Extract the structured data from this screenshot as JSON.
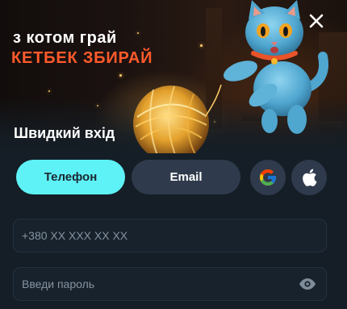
{
  "banner": {
    "headline_line1": "з котом грай",
    "headline_line2": "КЕТБЕК ЗБИРАЙ",
    "headline_line2_color": "#ff5a2b"
  },
  "modal": {
    "title": "Швидкий вхід",
    "close_icon": "close-icon"
  },
  "login_tabs": [
    {
      "label": "Телефон",
      "active": true
    },
    {
      "label": "Email",
      "active": false
    }
  ],
  "social_logins": [
    {
      "icon": "google-icon"
    },
    {
      "icon": "apple-icon"
    }
  ],
  "form": {
    "phone_placeholder": "+380 XX XXX XX XX",
    "password_placeholder": "Введи пароль",
    "password_toggle_icon": "eye-icon"
  },
  "colors": {
    "accent_active_tab": "#5ef2f6",
    "inactive_tab": "#2f3b4c",
    "background": "#151e26"
  }
}
